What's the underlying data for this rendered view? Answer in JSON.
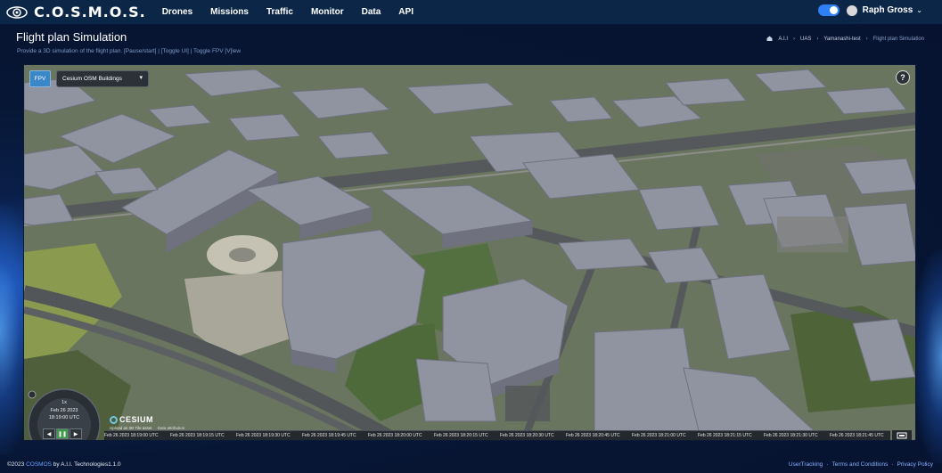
{
  "navbar": {
    "brand": "C.O.S.M.O.S.",
    "links": [
      "Drones",
      "Missions",
      "Traffic",
      "Monitor",
      "Data",
      "API"
    ],
    "user_name": "Raph Gross"
  },
  "header": {
    "title": "Flight plan Simulation",
    "subtitle": "Provide a 3D simulation of the flight plan. [Pause/start] | [Toggle UI] | Toggle FPV [V]iew",
    "breadcrumb": [
      "A.I.I",
      "UAS",
      "Yamanashi-test",
      "Flight plan Simulation"
    ]
  },
  "viewer": {
    "fpv_label": "FPV",
    "layer_selected": "Cesium OSM Buildings",
    "help_label": "?",
    "anim": {
      "speed": "1x",
      "date": "Feb 26 2023",
      "time": "18:19:00 UTC",
      "rewind": "◀",
      "pause": "❚❚",
      "play": "▶"
    },
    "cesium_label": "CESIUM",
    "credits": "Upload as 3D Tile asset",
    "credits_link": "Data attribution",
    "timeline": [
      "Feb 26 2023 18:19:00 UTC",
      "Feb 26 2023 18:19:15 UTC",
      "Feb 26 2023 18:19:30 UTC",
      "Feb 26 2023 18:19:45 UTC",
      "Feb 26 2023 18:20:00 UTC",
      "Feb 26 2023 18:20:15 UTC",
      "Feb 26 2023 18:20:30 UTC",
      "Feb 26 2023 18:20:45 UTC",
      "Feb 26 2023 18:21:00 UTC",
      "Feb 26 2023 18:21:15 UTC",
      "Feb 26 2023 18:21:30 UTC",
      "Feb 26 2023 18:21:45 UTC"
    ]
  },
  "footer": {
    "copyright_prefix": "©2023",
    "copyright_brand": "COSMOS",
    "copyright_suffix": "by A.I.I. Technologies1.1.0",
    "links": [
      "UserTracking",
      "Terms and Conditions",
      "Privacy Policy"
    ]
  },
  "colors": {
    "navbar": "#0c2647",
    "background": "#071634",
    "accent": "#2f7ff7",
    "building": "#8a8c95",
    "vegetation": "#4d5d3b"
  }
}
